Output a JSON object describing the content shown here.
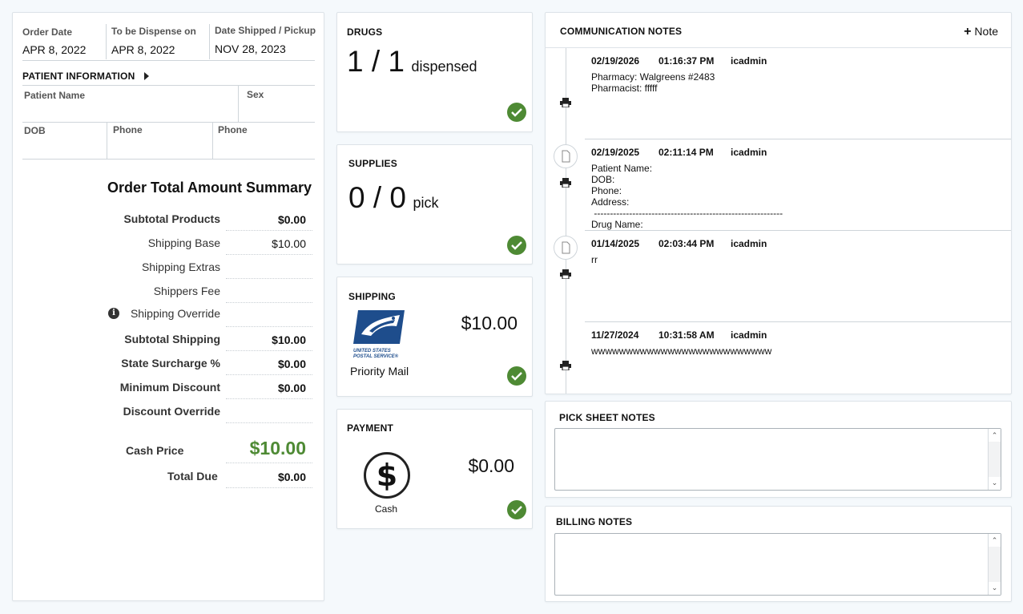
{
  "order": {
    "order_date_label": "Order Date",
    "order_date": "APR 8, 2022",
    "dispense_label": "To be Dispense on",
    "dispense_date": "APR 8, 2022",
    "shipped_label": "Date Shipped / Pickup",
    "shipped_date": "NOV 28, 2023"
  },
  "patient": {
    "section_title": "PATIENT INFORMATION",
    "name_label": "Patient Name",
    "sex_label": "Sex",
    "dob_label": "DOB",
    "phone1_label": "Phone",
    "phone2_label": "Phone"
  },
  "summary": {
    "title": "Order Total Amount Summary",
    "rows": [
      {
        "label": "Subtotal Products",
        "value": "$0.00"
      },
      {
        "label": "Shipping Base",
        "value": "$10.00"
      },
      {
        "label": "Shipping Extras",
        "value": ""
      },
      {
        "label": "Shippers Fee",
        "value": ""
      },
      {
        "label": "Shipping Override",
        "value": ""
      },
      {
        "label": "Subtotal Shipping",
        "value": "$10.00"
      },
      {
        "label": "State Surcharge %",
        "value": "$0.00"
      },
      {
        "label": "Minimum Discount",
        "value": "$0.00"
      },
      {
        "label": "Discount Override",
        "value": ""
      }
    ],
    "cash_price_label": "Cash Price",
    "cash_price": "$10.00",
    "total_due_label": "Total Due",
    "total_due": "$0.00",
    "info_icon": "info-icon"
  },
  "drugs": {
    "title": "DRUGS",
    "count": "1 / 1",
    "suffix": "dispensed"
  },
  "supplies": {
    "title": "SUPPLIES",
    "count": "0 / 0",
    "suffix": "pick"
  },
  "shipping": {
    "title": "SHIPPING",
    "amount": "$10.00",
    "method": "Priority Mail",
    "logo_line1": "UNITED STATES",
    "logo_line2": "POSTAL SERVICE",
    "logo_mark": "®"
  },
  "payment": {
    "title": "PAYMENT",
    "amount": "$0.00",
    "method": "Cash"
  },
  "comm_notes": {
    "title": "COMMUNICATION NOTES",
    "add_label": "Note",
    "entries": [
      {
        "date": "02/19/2026",
        "time": "01:16:37 PM",
        "user": "icadmin",
        "body": "Pharmacy: Walgreens #2483\nPharmacist: fffff"
      },
      {
        "date": "02/19/2025",
        "time": "02:11:14 PM",
        "user": "icadmin",
        "body": "Patient Name:\nDOB:\nPhone:\nAddress:\n -----------------------------------------------------------\nDrug Name:"
      },
      {
        "date": "01/14/2025",
        "time": "02:03:44 PM",
        "user": "icadmin",
        "body": "rr"
      },
      {
        "date": "11/27/2024",
        "time": "10:31:58 AM",
        "user": "icadmin",
        "body": "wwwwwwwwwwwwwwwwwwwwwwwwww"
      }
    ]
  },
  "pick_sheet": {
    "title": "PICK SHEET NOTES",
    "value": ""
  },
  "billing": {
    "title": "BILLING NOTES",
    "value": ""
  },
  "colors": {
    "accent_green": "#4e8a34",
    "usps_blue": "#1e4d8c"
  }
}
